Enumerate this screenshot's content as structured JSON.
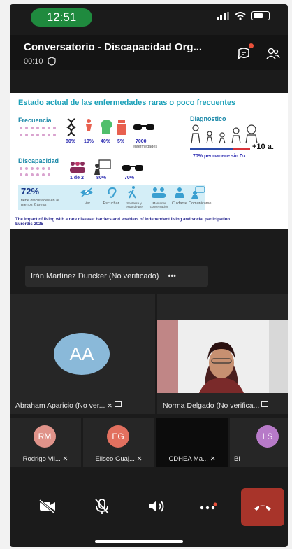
{
  "status_bar": {
    "time": "12:51"
  },
  "meeting": {
    "title": "Conversatorio - Discapacidad Org...",
    "timer": "00:10"
  },
  "slide": {
    "title": "Estado actual de las enfermedades raras o poco frecuentes",
    "frequency_label": "Frecuencia",
    "frequency_values": [
      "80%",
      "10%",
      "40%",
      "5%",
      "7000"
    ],
    "frequency_note": "enfermedades",
    "diagnosis_label": "Diagnóstico",
    "diagnosis_years": "+10 a.",
    "diagnosis_note": "70% permanece sin Dx",
    "disability_label": "Discapacidad",
    "disability_values": [
      "1 de 2",
      "80%",
      "70%"
    ],
    "big_stat": "72%",
    "big_stat_note": "tiene dificultades en al menos 2 áreas",
    "areas": [
      "Ver",
      "Escuchar",
      "Sentarse y estar de pie",
      "Mantener conversación",
      "Cuidarse",
      "Comunicarse"
    ],
    "reference_line1": "The impact of living with a rare disease: barriers and enablers of independent living and social participation.",
    "reference_line2": "Eurordis 2025"
  },
  "speaker_chip": {
    "label": "Irán Martínez Duncker (No verificado)",
    "more": "•••"
  },
  "tiles": [
    {
      "initials": "AA",
      "label": "Abraham Aparicio (No ver...",
      "color": "#8ab9d9"
    },
    {
      "label": "Norma Delgado (No verifica..."
    }
  ],
  "thumbnails": [
    {
      "initials": "RM",
      "label": "Rodrigo Vil...",
      "color": "#e0938a"
    },
    {
      "initials": "EG",
      "label": "Eliseo Guaj...",
      "color": "#e2705f"
    },
    {
      "initials": "",
      "label": "CDHEA Ma...",
      "color": ""
    },
    {
      "initials": "LS",
      "label": "Bl",
      "color": "#b77ac8"
    }
  ]
}
